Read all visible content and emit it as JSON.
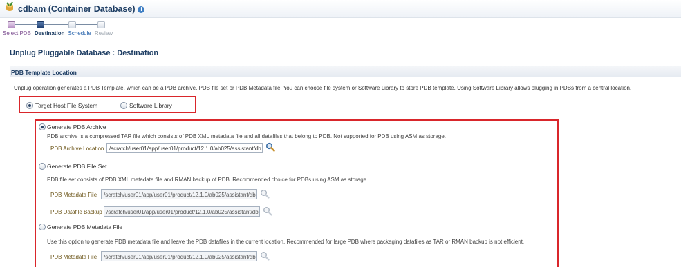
{
  "header": {
    "title": "cdbam (Container Database)",
    "info_icon": "info-icon",
    "db_icon": "database-icon"
  },
  "train": {
    "steps": [
      {
        "label": "Select PDB",
        "state": "visited"
      },
      {
        "label": "Destination",
        "state": "current"
      },
      {
        "label": "Schedule",
        "state": "future"
      },
      {
        "label": "Review",
        "state": "disabled"
      }
    ]
  },
  "page": {
    "heading": "Unplug Pluggable Database : Destination"
  },
  "section": {
    "title": "PDB Template Location",
    "description": "Unplug operation generates a PDB Template, which can be a PDB archive, PDB file set or PDB Metadata file. You can choose file system or Software Library to store PDB template. Using Software Library allows plugging in PDBs from a central location."
  },
  "location": {
    "target_host": "Target Host File System",
    "software_library": "Software Library",
    "selected": "target_host"
  },
  "options": {
    "archive": {
      "label": "Generate PDB Archive",
      "selected": true,
      "desc": "PDB archive is a compressed TAR file which consists of PDB XML metadata file and all datafiles that belong to PDB. Not supported for PDB using ASM as storage.",
      "field_label": "PDB Archive Location",
      "field_value": "/scratch/user01/app/user01/product/12.1.0/ab025/assistant/db"
    },
    "fileset": {
      "label": "Generate PDB File Set",
      "selected": false,
      "desc": "PDB file set consists of PDB XML metadata file and RMAN backup of PDB. Recommended choice for PDBs using ASM as storage.",
      "metadata_label": "PDB Metadata File",
      "metadata_value": "/scratch/user01/app/user01/product/12.1.0/ab025/assistant/db",
      "backup_label": "PDB Datafile Backup",
      "backup_value": "/scratch/user01/app/user01/product/12.1.0/ab025/assistant/db"
    },
    "metadata": {
      "label": "Generate PDB Metadata File",
      "selected": false,
      "desc": "Use this option to generate PDB metadata file and leave the PDB datafiles in the current location. Recommended for large PDB where packaging datafiles as TAR or RMAN backup is not efficient.",
      "field_label": "PDB Metadata File",
      "field_value": "/scratch/user01/app/user01/product/12.1.0/ab025/assistant/db"
    }
  },
  "colors": {
    "highlight_box": "#d9262b",
    "heading": "#1d3d63",
    "field_label": "#6b5417"
  }
}
